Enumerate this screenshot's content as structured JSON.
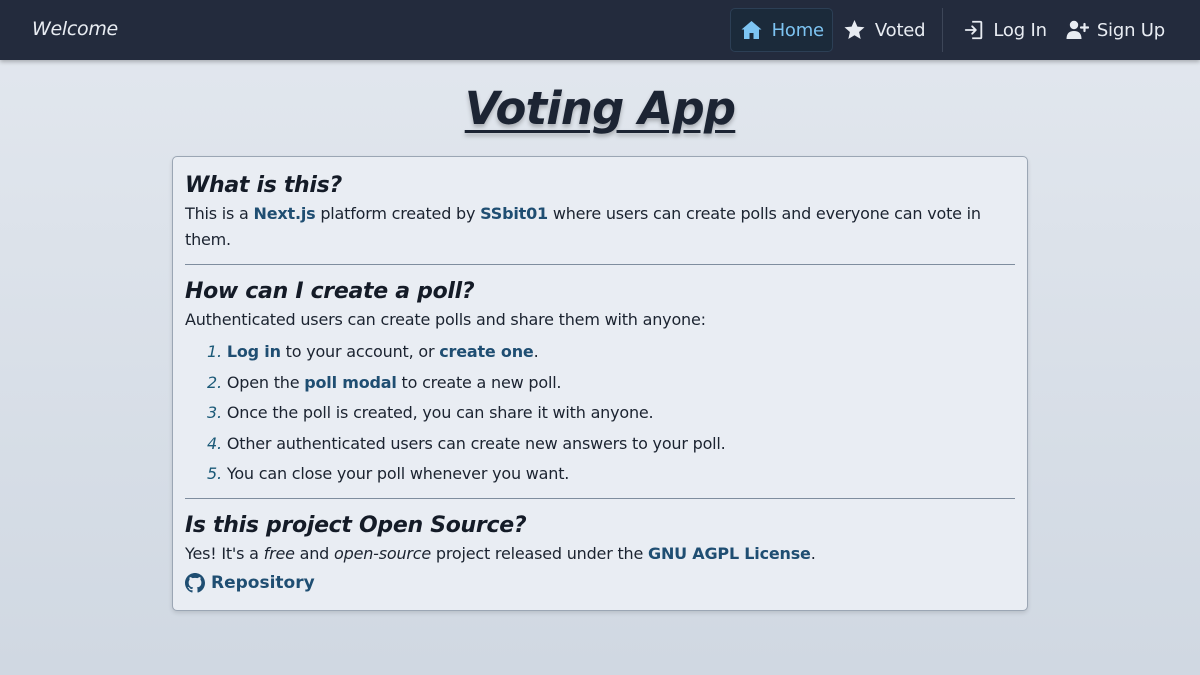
{
  "nav": {
    "brand": "Welcome",
    "items": [
      {
        "label": "Home",
        "icon": "home-icon",
        "active": true
      },
      {
        "label": "Voted",
        "icon": "star-icon",
        "active": false
      },
      {
        "label": "Log In",
        "icon": "login-icon",
        "active": false
      },
      {
        "label": "Sign Up",
        "icon": "user-plus-icon",
        "active": false
      }
    ]
  },
  "page": {
    "title": "Voting App"
  },
  "sections": {
    "what": {
      "heading": "What is this?",
      "text_1": "This is a ",
      "link_nextjs": "Next.js",
      "text_2": " platform created by ",
      "link_author": "SSbit01",
      "text_3": " where users can create polls and everyone can vote in them."
    },
    "how": {
      "heading": "How can I create a poll?",
      "intro": "Authenticated users can create polls and share them with anyone:",
      "steps": [
        {
          "num": "1.",
          "link_a": "Log in",
          "text_a": " to your account, or ",
          "link_b": "create one",
          "text_b": "."
        },
        {
          "num": "2.",
          "text_a": "Open the ",
          "link_a": "poll modal",
          "text_b": " to create a new poll."
        },
        {
          "num": "3.",
          "text": "Once the poll is created, you can share it with anyone."
        },
        {
          "num": "4.",
          "text": "Other authenticated users can create new answers to your poll."
        },
        {
          "num": "5.",
          "text": "You can close your poll whenever you want."
        }
      ]
    },
    "opensource": {
      "heading": "Is this project Open Source?",
      "text_1": "Yes! It's a ",
      "em_free": "free",
      "text_2": " and ",
      "em_open": "open-source",
      "text_3": " project released under the ",
      "link_license": "GNU AGPL License",
      "text_4": ".",
      "repo_label": "Repository",
      "repo_icon": "github-icon"
    }
  },
  "colors": {
    "navbar": "#232b3d",
    "active_nav": "#7dc4f2",
    "link": "#1f4e72",
    "card": "#e9edf3"
  }
}
